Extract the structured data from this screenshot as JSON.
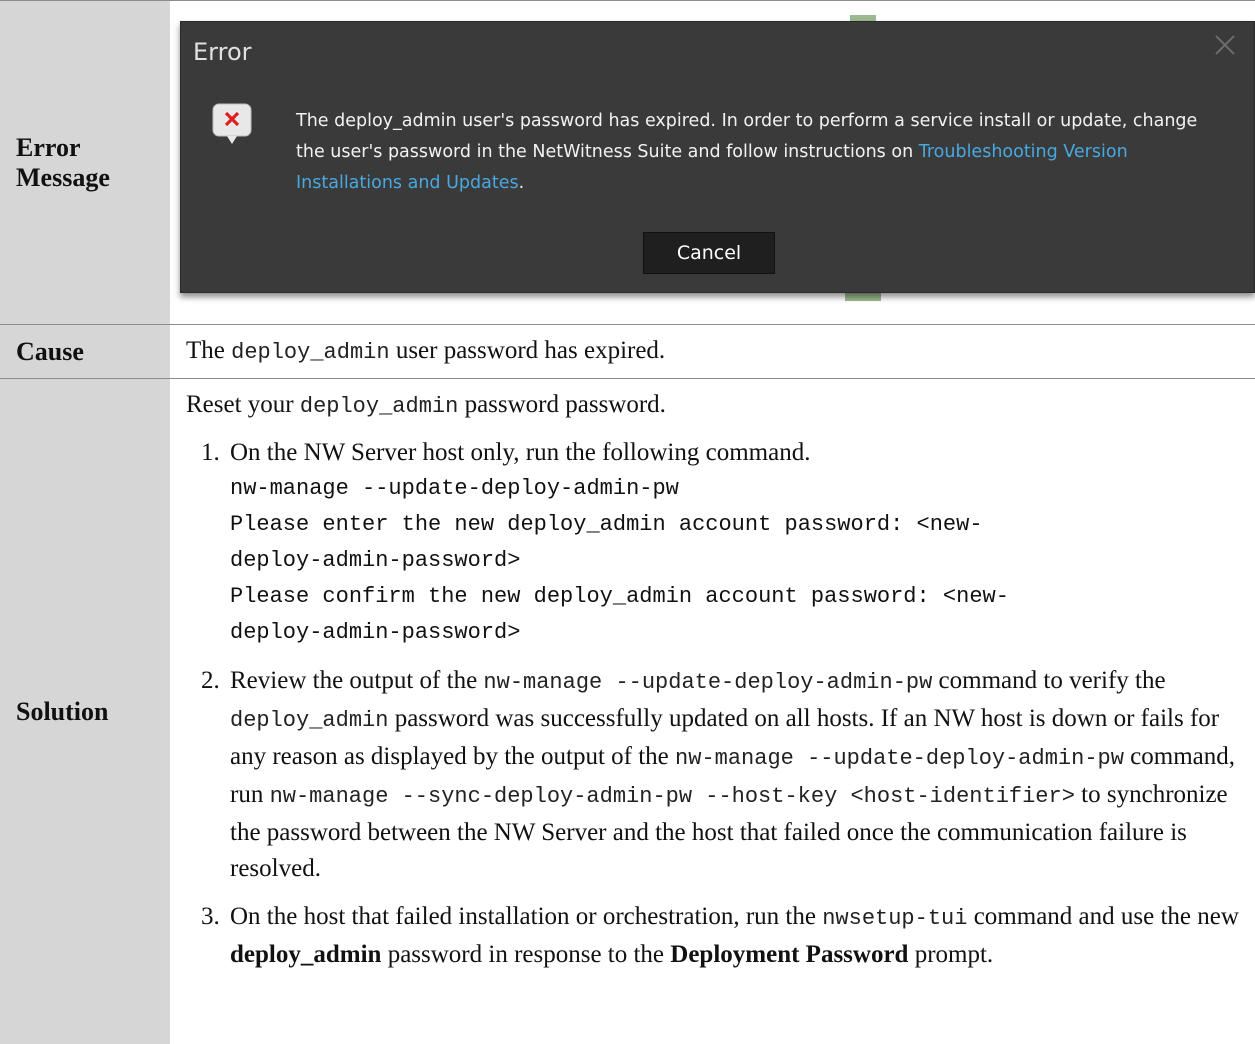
{
  "labels": {
    "error_message": "Error Message",
    "cause": "Cause",
    "solution": "Solution"
  },
  "dialog": {
    "title": "Error",
    "message": "The deploy_admin user's password has expired. In order to perform a service install or update, change the user's password in the NetWitness Suite and follow instructions on ",
    "link_text": "Troubleshooting Version Installations and Updates",
    "message_end": ".",
    "cancel_label": "Cancel",
    "close_icon": "close-icon",
    "error_icon": "error-icon",
    "colors": {
      "background": "#3a3a3a",
      "link": "#49a8e0",
      "error_x": "#e02020"
    }
  },
  "cause": {
    "pre": "The ",
    "code": "deploy_admin",
    "post": " user password has expired."
  },
  "solution": {
    "intro_pre": "Reset your ",
    "intro_code": "deploy_admin",
    "intro_post": " password password.",
    "step1": {
      "text": "On the NW Server host only, run the following command.",
      "code_lines": [
        "nw-manage --update-deploy-admin-pw",
        "Please enter the new deploy_admin account password: <new-",
        "deploy-admin-password>",
        "Please confirm the new deploy_admin account password: <new-",
        "deploy-admin-password>"
      ]
    },
    "step2": {
      "t1": "Review the output of the ",
      "c1": "nw-manage --update-deploy-admin-pw",
      "t2": " command to verify the ",
      "c2": "deploy_admin",
      "t3": " password was successfully updated on all hosts. If an NW host is down or fails for any reason as displayed by the output of the ",
      "c3": "nw-manage --update-deploy-admin-pw",
      "t4": " command, run ",
      "c4": "nw-manage --sync-deploy-admin-pw --host-key <host-identifier>",
      "t5": " to synchronize the password between the NW Server and the host that failed once the communication failure is resolved."
    },
    "step3": {
      "t1": "On the host that failed installation or orchestration, run the ",
      "c1": "nwsetup-tui",
      "t2": "  command and use the new ",
      "b1": "deploy_admin",
      "t3": " password in response to the ",
      "b2": "Deployment Password",
      "t4": " prompt."
    }
  }
}
